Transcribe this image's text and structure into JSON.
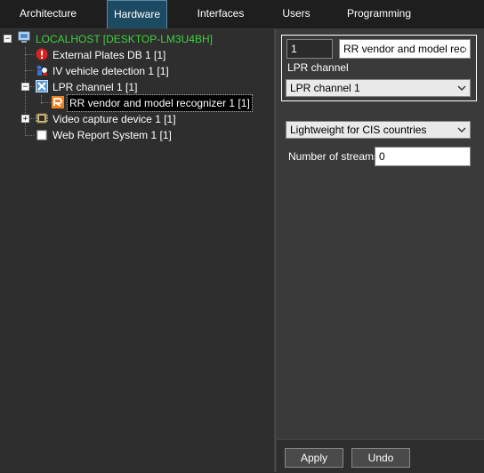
{
  "tabs": [
    {
      "label": "Architecture"
    },
    {
      "label": "Hardware",
      "active": true
    },
    {
      "label": "Interfaces"
    },
    {
      "label": "Users"
    },
    {
      "label": "Programming"
    }
  ],
  "tree": {
    "root": "LOCALHOST [DESKTOP-LM3U4BH]",
    "items": [
      {
        "label": "External Plates DB 1 [1]",
        "icon": "error-icon"
      },
      {
        "label": "IV vehicle detection 1 [1]",
        "icon": "vehicle-detection-icon"
      },
      {
        "label": "LPR channel  1 [1]",
        "icon": "lpr-channel-icon"
      },
      {
        "label": "RR vendor and model recognizer 1 [1]",
        "icon": "recognizer-icon"
      },
      {
        "label": "Video capture device 1 [1]",
        "icon": "capture-device-icon"
      },
      {
        "label": "Web Report System 1 [1]",
        "icon": "web-report-icon"
      }
    ]
  },
  "settings": {
    "id_value": "1",
    "name_value": "RR vendor and model recogn",
    "lpr_channel_label": "LPR channel",
    "lpr_channel_selected": "LPR channel  1",
    "mode_selected": "Lightweight for CIS countries",
    "streams_label": "Number of streams:",
    "streams_value": "0"
  },
  "footer": {
    "apply_label": "Apply",
    "undo_label": "Undo"
  },
  "colors": {
    "root_text": "#3fcf3f",
    "active_tab": "#1d4a63"
  }
}
